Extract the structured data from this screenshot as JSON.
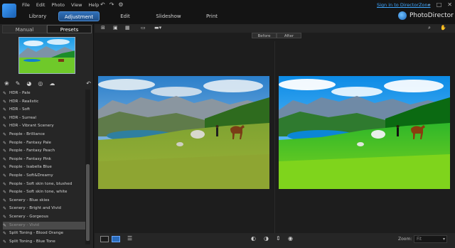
{
  "menu": [
    "File",
    "Edit",
    "Photo",
    "View",
    "Help"
  ],
  "signin": "Sign in to DirectorZone",
  "brand": "PhotoDirector",
  "tabs": [
    {
      "label": "Library",
      "active": false
    },
    {
      "label": "Adjustment",
      "active": true
    },
    {
      "label": "Edit",
      "active": false
    },
    {
      "label": "Slideshow",
      "active": false
    },
    {
      "label": "Print",
      "active": false
    }
  ],
  "subtabs": {
    "manual": "Manual",
    "presets": "Presets"
  },
  "presets": [
    "HDR - Pale",
    "HDR - Realistic",
    "HDR - Soft",
    "HDR - Surreal",
    "HDR - Vibrant Scenery",
    "People - Brilliance",
    "People - Fantasy Pale",
    "People - Fantasy Peach",
    "People - Fantasy Pink",
    "People - Isabella Blue",
    "People - Soft&Dreamy",
    "People - Soft skin tone, blushed",
    "People - Soft skin tone, white",
    "Scenery - Blue skies",
    "Scenery - Bright and Vivid",
    "Scenery - Gorgeous",
    "Scenery - Vivid",
    "Split Toning - Blood Orange",
    "Split Toning - Blue Tone"
  ],
  "selected_preset_index": 16,
  "viewer": {
    "before": "Before",
    "after": "After"
  },
  "zoom": {
    "label": "Zoom:",
    "value": "Fit"
  },
  "colors": {
    "accent": "#2a6cbc",
    "link": "#3ea7ff",
    "background": "#1e1e1e"
  }
}
